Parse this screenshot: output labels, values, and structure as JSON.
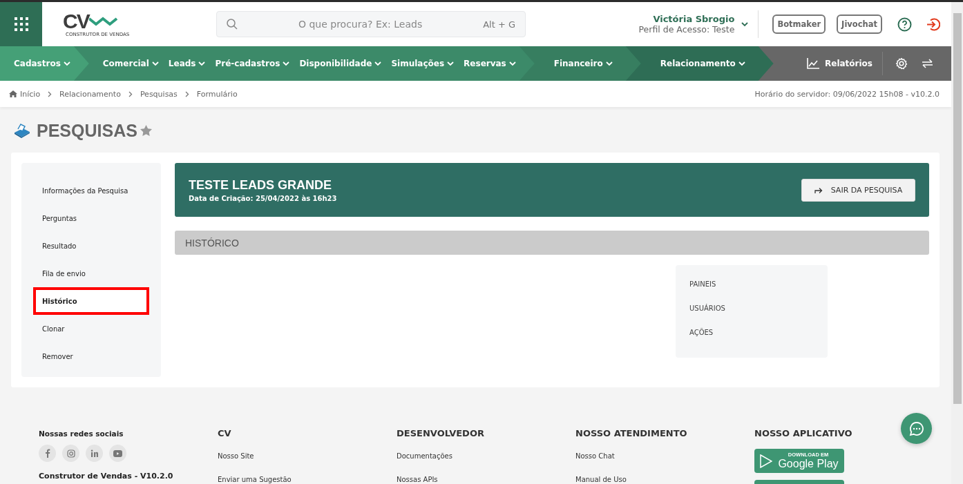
{
  "header": {
    "logo_text": "CV",
    "logo_caption": "CONSTRUTOR DE VENDAS",
    "search": {
      "placeholder": "O que procura? Ex: Leads",
      "shortcut": "Alt + G"
    },
    "user": {
      "name": "Victória Sbrogio",
      "profile": "Perfil de Acesso: Teste"
    },
    "buttons": [
      "Botmaker",
      "Jivochat"
    ]
  },
  "nav": {
    "groups": [
      {
        "color": "#45a077",
        "items": [
          "Cadastros"
        ]
      },
      {
        "color": "#3c8a69",
        "items": [
          "Comercial",
          "Leads",
          "Pré-cadastros",
          "Disponibilidade",
          "Simulações",
          "Reservas"
        ]
      },
      {
        "color": "#377e60",
        "items": [
          "Financeiro"
        ]
      },
      {
        "color": "#2e6d55",
        "items": [
          "Relacionamento"
        ]
      }
    ],
    "reports": "Relatórios"
  },
  "breadcrumb": {
    "items": [
      "Início",
      "Relacionamento",
      "Pesquisas",
      "Formulário"
    ],
    "server_time": "Horário do servidor: 09/06/2022 15h08 - v10.2.0"
  },
  "page_title": "PESQUISAS",
  "starred": false,
  "side_menu": [
    {
      "label": "Informações da Pesquisa",
      "selected": false
    },
    {
      "label": "Perguntas",
      "selected": false
    },
    {
      "label": "Resultado",
      "selected": false
    },
    {
      "label": "Fila de envio",
      "selected": false
    },
    {
      "label": "Histórico",
      "selected": true
    },
    {
      "label": "Clonar",
      "selected": false
    },
    {
      "label": "Remover",
      "selected": false
    }
  ],
  "survey": {
    "title": "TESTE LEADS GRANDE",
    "created": "Data de Criação: 25/04/2022 às 16h23",
    "exit_button": "SAIR DA PESQUISA"
  },
  "section_title": "HISTÓRICO",
  "history_menu": [
    "PAINEIS",
    "USUÁRIOS",
    "AÇÕES"
  ],
  "footer": {
    "social_title": "Nossas redes sociais",
    "version": "Construtor de Vendas - V10.2.0",
    "columns": [
      {
        "title": "CV",
        "links": [
          "Nosso Site",
          "Enviar uma Sugestão"
        ]
      },
      {
        "title": "DESENVOLVEDOR",
        "links": [
          "Documentações",
          "Nossas APIs"
        ]
      },
      {
        "title": "NOSSO ATENDIMENTO",
        "links": [
          "Nosso Chat",
          "Manual de Uso"
        ]
      }
    ],
    "app": {
      "title": "NOSSO APLICATIVO",
      "badge_caption": "DOWNLOAD EM",
      "badge_store": "Google Play"
    }
  }
}
